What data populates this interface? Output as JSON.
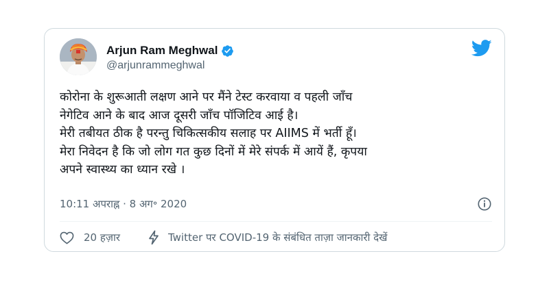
{
  "author": {
    "name": "Arjun Ram Meghwal",
    "handle": "@arjunrammeghwal",
    "verified": true
  },
  "tweet": {
    "lines": [
      "कोरोना के शुरूआती लक्षण आने पर मैंने टेस्ट करवाया व पहली जाँच",
      "नेगेटिव आने के बाद आज दूसरी जाँच पॉजिटिव आई है।",
      "मेरी तबीयत ठीक है परन्तु चिकित्सकीय सलाह पर AIIMS में भर्ती हूँ।",
      "मेरा निवेदन है कि जो लोग गत कुछ दिनों में मेरे संपर्क में आयें हैं, कृपया",
      "अपने स्वास्थ्य का ध्यान रखे ।"
    ],
    "timestamp": "10:11 अपराह्न · 8 अग॰ 2020"
  },
  "actions": {
    "like_count": "20 हज़ार",
    "covid_info": "Twitter पर COVID-19 के संबंधित ताज़ा जानकारी देखें"
  },
  "icons": {
    "verified": "verified-badge-icon",
    "brand": "twitter-bird-icon",
    "info": "info-icon",
    "like": "heart-icon",
    "covid": "lightning-icon"
  },
  "colors": {
    "brand_blue": "#1d9bf0",
    "text_primary": "#0f1419",
    "text_secondary": "#536471",
    "border": "#cfd9de"
  }
}
